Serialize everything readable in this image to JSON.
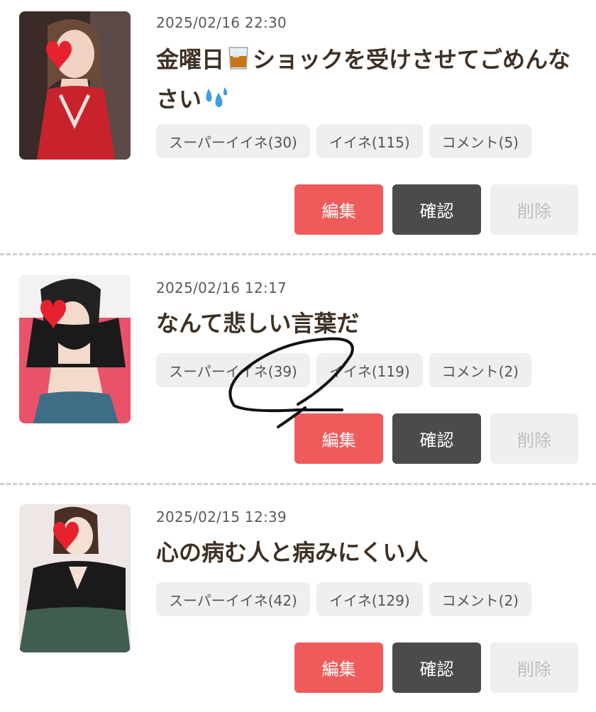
{
  "posts": [
    {
      "date": "2025/02/16 22:30",
      "title_part1": "金曜日",
      "title_icon": "whisky-glass-icon",
      "title_part2": "ショックを受けさせてごめんなさい",
      "title_end_icon": "sweat-drops-icon",
      "stats": {
        "super_like": "スーパーイイネ(30)",
        "like": "イイネ(115)",
        "comment": "コメント(5)"
      },
      "thumb_colors": {
        "bg": "#3a2a28",
        "dress": "#c8232c",
        "hair": "#6b4a3a"
      }
    },
    {
      "date": "2025/02/16 12:17",
      "title": "なんて悲しい言葉だ",
      "stats": {
        "super_like": "スーパーイイネ(39)",
        "like": "イイネ(119)",
        "comment": "コメント(2)"
      },
      "thumb_colors": {
        "bg": "#e8536a",
        "top": "#1a1a1a",
        "skirt": "#3d6e86"
      }
    },
    {
      "date": "2025/02/15 12:39",
      "title": "心の病む人と病みにくい人",
      "stats": {
        "super_like": "スーパーイイネ(42)",
        "like": "イイネ(129)",
        "comment": "コメント(2)"
      },
      "thumb_colors": {
        "bg": "#efe6e6",
        "top": "#1a1a1a",
        "skirt": "#3f5e4f"
      }
    }
  ],
  "buttons": {
    "edit": "編集",
    "confirm": "確認",
    "delete": "削除"
  },
  "colors": {
    "edit": "#ef5b5b",
    "confirm": "#4b4b4b",
    "delete_bg": "#efefef",
    "title": "#3e3024",
    "separator": "#d0d0d0"
  },
  "heart_icon": "heart-sticker-icon"
}
